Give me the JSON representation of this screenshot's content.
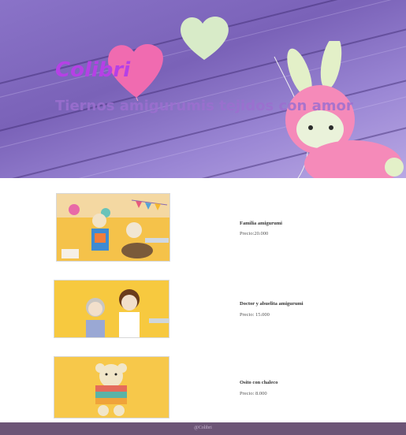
{
  "hero": {
    "title": "Colibri",
    "subtitle": "Tiernos amigurumis tejidos con amor"
  },
  "products": [
    {
      "name": "Familia amigurumi",
      "price": "Precio:20.000",
      "image": "amigurumi-family-photo"
    },
    {
      "name": "Doctor y abuelita amigurumi",
      "price": "Precio: 15.000",
      "image": "amigurumi-doctor-grandma-photo"
    },
    {
      "name": "Osito con chaleco",
      "price": "Precio: 8.000",
      "image": "amigurumi-teddy-bear-photo"
    }
  ],
  "footer": {
    "text": "@Colibri"
  },
  "colors": {
    "hero_bg": "#8a73c8",
    "title": "#b640e6",
    "footer_bg": "#6c5576",
    "product_bg": "#f6c545"
  }
}
